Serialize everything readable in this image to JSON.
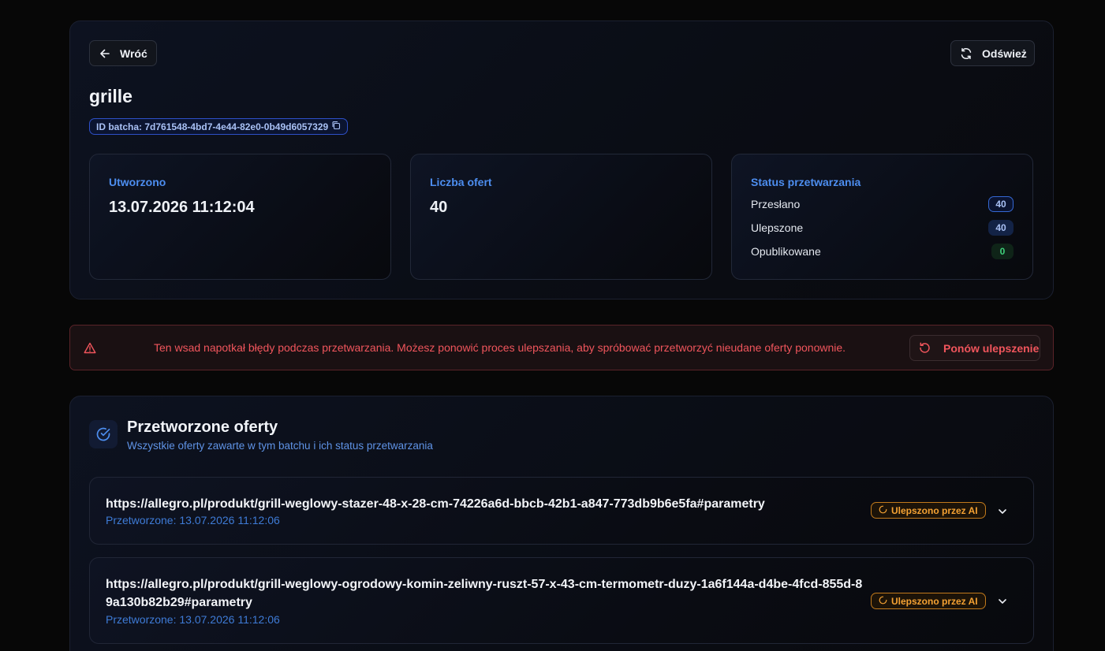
{
  "header": {
    "back_label": "Wróć",
    "refresh_label": "Odśwież",
    "title": "grille",
    "batch_id": "ID batcha: 7d761548-4bd7-4e44-82e0-0b49d6057329"
  },
  "stats": {
    "created_label": "Utworzono",
    "created_value": "13.07.2026 11:12:04",
    "offers_label": "Liczba ofert",
    "offers_value": "40",
    "status_label": "Status przetwarzania",
    "statuses": [
      {
        "name": "Przesłano",
        "count": "40",
        "color": "#4d8ef0"
      },
      {
        "name": "Ulepszone",
        "count": "40",
        "color": "#4d8ef0"
      },
      {
        "name": "Opublikowane",
        "count": "0",
        "color": "#27c26a"
      }
    ]
  },
  "alert": {
    "message": "Ten wsad napotkał błędy podczas przetwarzania. Możesz ponowić proces ulepszania, aby spróbować przetworzyć nieudane oferty ponownie.",
    "retry_label": "Ponów ulepszenie",
    "color": "#f0555c"
  },
  "offers_section": {
    "title": "Przetworzone oferty",
    "subtitle": "Wszystkie oferty zawarte w tym batchu i ich status przetwarzania",
    "items": [
      {
        "url": "https://allegro.pl/produkt/grill-weglowy-stazer-48-x-28-cm-74226a6d-bbcb-42b1-a847-773db9b6e5fa#parametry",
        "processed": "Przetworzone: 13.07.2026 11:12:06",
        "badge": "Ulepszono przez AI"
      },
      {
        "url": "https://allegro.pl/produkt/grill-weglowy-ogrodowy-komin-zeliwny-ruszt-57-x-43-cm-termometr-duzy-1a6f144a-d4be-4fcd-855d-89a130b82b29#parametry",
        "processed": "Przetworzone: 13.07.2026 11:12:06",
        "badge": "Ulepszono przez AI"
      }
    ]
  },
  "colors": {
    "accent": "#4d8ef0",
    "warning": "#f5a233",
    "danger": "#f0555c",
    "success": "#27c26a"
  }
}
